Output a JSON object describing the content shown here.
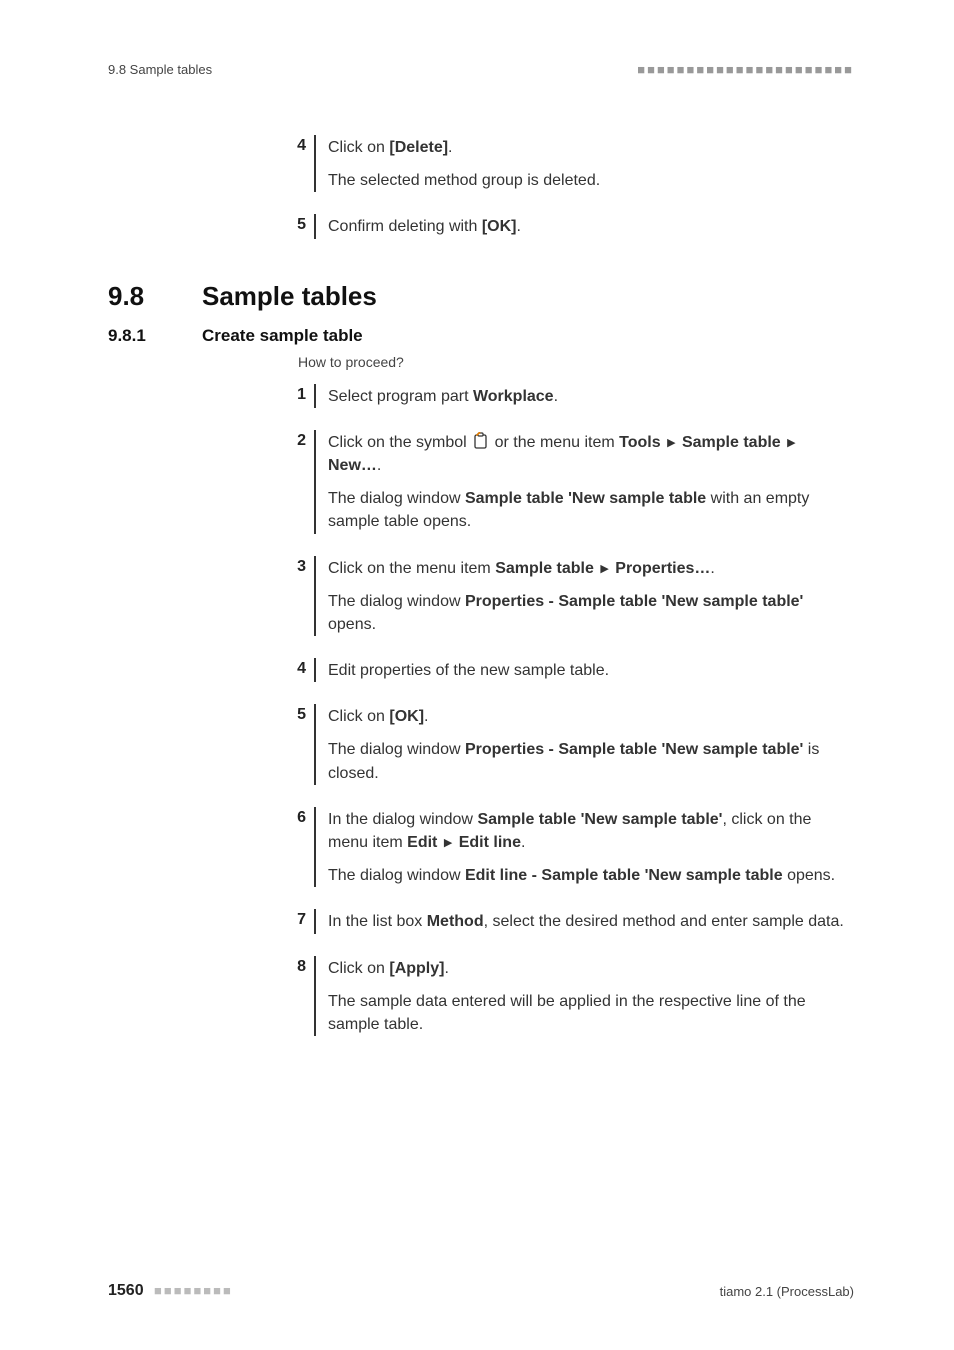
{
  "header": {
    "left": "9.8 Sample tables",
    "right": "■■■■■■■■■■■■■■■■■■■■■■"
  },
  "intro_steps": [
    {
      "num": "4",
      "parts": [
        {
          "t": "Click on ",
          "b": false
        },
        {
          "t": "[Delete]",
          "b": true
        },
        {
          "t": ".",
          "b": false
        }
      ],
      "result": "The selected method group is deleted."
    },
    {
      "num": "5",
      "parts": [
        {
          "t": "Confirm deleting with ",
          "b": false
        },
        {
          "t": "[OK]",
          "b": true
        },
        {
          "t": ".",
          "b": false
        }
      ]
    }
  ],
  "section": {
    "num": "9.8",
    "title": "Sample tables"
  },
  "subsection": {
    "num": "9.8.1",
    "title": "Create sample table"
  },
  "howto": "How to proceed?",
  "steps": [
    {
      "num": "1",
      "parts": [
        {
          "t": "Select program part ",
          "b": false
        },
        {
          "t": "Workplace",
          "b": true
        },
        {
          "t": ".",
          "b": false
        }
      ]
    },
    {
      "num": "2",
      "parts": [
        {
          "t": "Click on the symbol ",
          "b": false
        },
        {
          "icon": true
        },
        {
          "t": " or the menu item ",
          "b": false
        },
        {
          "t": "Tools",
          "b": true
        },
        {
          "tri": true
        },
        {
          "t": "Sample table",
          "b": true
        },
        {
          "tri": true
        },
        {
          "t": "New…",
          "b": true
        },
        {
          "t": ".",
          "b": false
        }
      ],
      "result_parts": [
        {
          "t": "The dialog window ",
          "b": false
        },
        {
          "t": "Sample table 'New sample table",
          "b": true
        },
        {
          "t": " with an empty sample table opens.",
          "b": false
        }
      ]
    },
    {
      "num": "3",
      "parts": [
        {
          "t": "Click on the menu item ",
          "b": false
        },
        {
          "t": "Sample table",
          "b": true
        },
        {
          "tri": true
        },
        {
          "t": "Properties…",
          "b": true
        },
        {
          "t": ".",
          "b": false
        }
      ],
      "result_parts": [
        {
          "t": "The dialog window ",
          "b": false
        },
        {
          "t": "Properties - Sample table 'New sample table'",
          "b": true
        },
        {
          "t": " opens.",
          "b": false
        }
      ]
    },
    {
      "num": "4",
      "parts": [
        {
          "t": "Edit properties of the new sample table.",
          "b": false
        }
      ]
    },
    {
      "num": "5",
      "parts": [
        {
          "t": "Click on ",
          "b": false
        },
        {
          "t": "[OK]",
          "b": true
        },
        {
          "t": ".",
          "b": false
        }
      ],
      "result_parts": [
        {
          "t": "The dialog window ",
          "b": false
        },
        {
          "t": "Properties - Sample table 'New sample table'",
          "b": true
        },
        {
          "t": " is closed.",
          "b": false
        }
      ]
    },
    {
      "num": "6",
      "parts": [
        {
          "t": "In the dialog window ",
          "b": false
        },
        {
          "t": "Sample table 'New sample table'",
          "b": true
        },
        {
          "t": ", click on the menu item ",
          "b": false
        },
        {
          "t": "Edit",
          "b": true
        },
        {
          "tri": true
        },
        {
          "t": "Edit line",
          "b": true
        },
        {
          "t": ".",
          "b": false
        }
      ],
      "result_parts": [
        {
          "t": "The dialog window ",
          "b": false
        },
        {
          "t": "Edit line - Sample table 'New sample table",
          "b": true
        },
        {
          "t": " opens.",
          "b": false
        }
      ]
    },
    {
      "num": "7",
      "parts": [
        {
          "t": "In the list box ",
          "b": false
        },
        {
          "t": "Method",
          "b": true
        },
        {
          "t": ", select the desired method and enter sample data.",
          "b": false
        }
      ]
    },
    {
      "num": "8",
      "parts": [
        {
          "t": "Click on ",
          "b": false
        },
        {
          "t": "[Apply]",
          "b": true
        },
        {
          "t": ".",
          "b": false
        }
      ],
      "result": "The sample data entered will be applied in the respective line of the sample table."
    }
  ],
  "footer": {
    "page": "1560",
    "dots": "■■■■■■■■",
    "right": "tiamo 2.1 (ProcessLab)"
  },
  "tri_glyph": "▶"
}
